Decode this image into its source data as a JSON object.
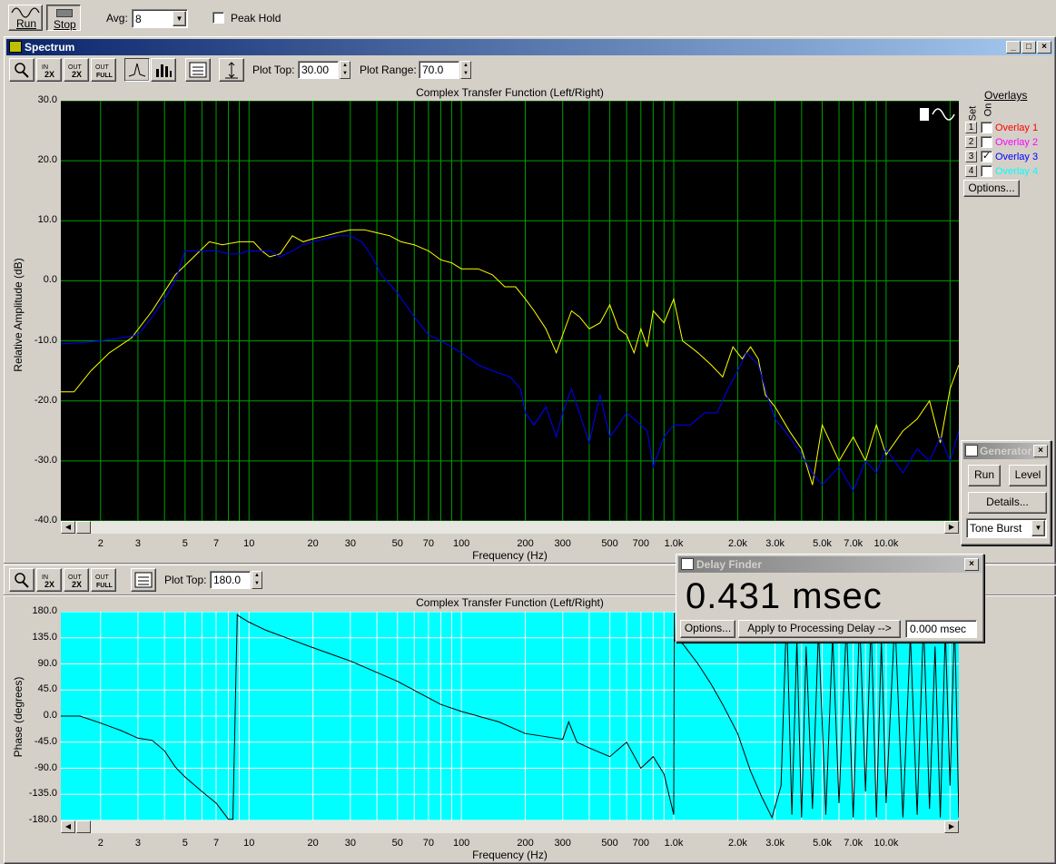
{
  "toolbar": {
    "run_label": "Run",
    "stop_label": "Stop",
    "avg_label": "Avg:",
    "avg_value": "8",
    "peak_hold_label": "Peak Hold"
  },
  "spectrum_window": {
    "title": "Spectrum",
    "plot_top_label": "Plot Top:",
    "plot_top_value": "30.00",
    "plot_range_label": "Plot Range:",
    "plot_range_value": "70.0"
  },
  "phase_toolbar": {
    "plot_top_label": "Plot Top:",
    "plot_top_value": "180.0"
  },
  "overlays": {
    "title": "Overlays",
    "set_label": "Set",
    "on_label": "On",
    "items": [
      {
        "num": "1",
        "label": "Overlay 1",
        "color": "#ff0000",
        "checked": false
      },
      {
        "num": "2",
        "label": "Overlay 2",
        "color": "#ff00ff",
        "checked": false
      },
      {
        "num": "3",
        "label": "Overlay 3",
        "color": "#0000ff",
        "checked": true
      },
      {
        "num": "4",
        "label": "Overlay 4",
        "color": "#00ffff",
        "checked": false
      }
    ],
    "options_label": "Options..."
  },
  "generator": {
    "title": "Generator",
    "run_label": "Run",
    "level_label": "Level",
    "details_label": "Details...",
    "signal_value": "Tone Burst"
  },
  "delay_finder": {
    "title": "Delay Finder",
    "value": "0.431 msec",
    "options_label": "Options...",
    "apply_label": "Apply to Processing Delay -->",
    "delay_value": "0.000 msec"
  },
  "chart_data": [
    {
      "type": "line",
      "title": "Complex Transfer Function (Left/Right)",
      "xlabel": "Frequency (Hz)",
      "ylabel": "Relative Amplitude (dB)",
      "x_scale": "log",
      "xlim": [
        1.3,
        22000
      ],
      "ylim": [
        -40,
        30
      ],
      "yticks": [
        "30.0",
        "20.0",
        "10.0",
        "0.0",
        "-10.0",
        "-20.0",
        "-30.0",
        "-40.0"
      ],
      "xticks": [
        {
          "v": 2,
          "label": "2"
        },
        {
          "v": 3,
          "label": "3"
        },
        {
          "v": 5,
          "label": "5"
        },
        {
          "v": 7,
          "label": "7"
        },
        {
          "v": 10,
          "label": "10"
        },
        {
          "v": 20,
          "label": "20"
        },
        {
          "v": 30,
          "label": "30"
        },
        {
          "v": 50,
          "label": "50"
        },
        {
          "v": 70,
          "label": "70"
        },
        {
          "v": 100,
          "label": "100"
        },
        {
          "v": 200,
          "label": "200"
        },
        {
          "v": 300,
          "label": "300"
        },
        {
          "v": 500,
          "label": "500"
        },
        {
          "v": 700,
          "label": "700"
        },
        {
          "v": 1000,
          "label": "1.0k"
        },
        {
          "v": 2000,
          "label": "2.0k"
        },
        {
          "v": 3000,
          "label": "3.0k"
        },
        {
          "v": 5000,
          "label": "5.0k"
        },
        {
          "v": 7000,
          "label": "7.0k"
        },
        {
          "v": 10000,
          "label": "10.0k"
        }
      ],
      "background": "#000000",
      "grid_color": "#00a000",
      "series": [
        {
          "color": "#ffff00",
          "x": [
            1.3,
            1.5,
            1.8,
            2.2,
            2.8,
            3.5,
            4.5,
            5.5,
            6.5,
            7.5,
            9,
            10.5,
            11.5,
            12.5,
            14,
            16,
            18,
            20,
            23,
            26,
            30,
            35,
            40,
            46,
            52,
            60,
            70,
            80,
            90,
            100,
            120,
            140,
            160,
            180,
            200,
            220,
            250,
            280,
            300,
            330,
            360,
            400,
            450,
            500,
            550,
            600,
            650,
            700,
            750,
            800,
            900,
            1000,
            1100,
            1200,
            1300,
            1500,
            1700,
            1900,
            2100,
            2300,
            2500,
            2700,
            3000,
            3500,
            4000,
            4500,
            5000,
            6000,
            7000,
            8000,
            9000,
            10000,
            12000,
            14000,
            16000,
            18000,
            20000,
            22000
          ],
          "y": [
            -18.5,
            -18.5,
            -15,
            -12,
            -9.5,
            -5,
            1,
            4,
            6.5,
            6,
            6.5,
            6.5,
            5,
            4,
            4.5,
            7.5,
            6.5,
            7,
            7.5,
            8,
            8.5,
            8.5,
            8,
            7.5,
            6.5,
            6,
            5,
            3.5,
            3,
            2,
            2,
            1,
            -1,
            -1,
            -3,
            -5,
            -8,
            -12,
            -9,
            -5,
            -6,
            -8,
            -7,
            -4,
            -8,
            -9,
            -12,
            -8,
            -11,
            -5,
            -7,
            -3,
            -10,
            -11,
            -12,
            -14,
            -16,
            -11,
            -13,
            -11,
            -13,
            -19,
            -21,
            -25,
            -28,
            -34,
            -24,
            -30,
            -26,
            -30,
            -24,
            -29,
            -25,
            -23,
            -20,
            -27,
            -18,
            -14
          ]
        },
        {
          "color": "#0000ff",
          "x": [
            1.3,
            1.6,
            2,
            2.5,
            3,
            3.5,
            4,
            4.5,
            5,
            5.5,
            6,
            7,
            8,
            9,
            10,
            11.5,
            12.5,
            14,
            16,
            18,
            20,
            23,
            26,
            30,
            34,
            38,
            42,
            50,
            60,
            70,
            80,
            90,
            100,
            120,
            140,
            170,
            190,
            200,
            220,
            250,
            280,
            300,
            330,
            360,
            400,
            450,
            500,
            550,
            600,
            700,
            750,
            800,
            900,
            1000,
            1200,
            1400,
            1600,
            1800,
            2000,
            2200,
            2500,
            2800,
            3000,
            3500,
            4000,
            4500,
            5000,
            6000,
            7000,
            8000,
            9000,
            10000,
            12000,
            14000,
            16000,
            18000,
            20000,
            22000
          ],
          "y": [
            -10.5,
            -10.3,
            -10,
            -9.5,
            -9,
            -6,
            -3,
            0,
            5,
            5,
            5,
            5,
            4.5,
            4.5,
            5,
            5,
            5,
            4,
            5,
            6,
            6.5,
            7,
            7.5,
            7.5,
            6.5,
            4,
            1,
            -2,
            -6,
            -9,
            -10,
            -11,
            -12,
            -14,
            -15,
            -16,
            -18,
            -22,
            -24,
            -21,
            -26,
            -22,
            -18,
            -22,
            -27,
            -19,
            -26,
            -24,
            -22,
            -24,
            -25,
            -31,
            -26,
            -24,
            -24,
            -22,
            -22,
            -18,
            -15,
            -12,
            -14,
            -20,
            -23,
            -26,
            -29,
            -32,
            -34,
            -31,
            -35,
            -30,
            -32,
            -28,
            -32,
            -28,
            -30,
            -26,
            -30,
            -25
          ]
        }
      ]
    },
    {
      "type": "line",
      "title": "Complex Transfer Function (Left/Right)",
      "xlabel": "Frequency (Hz)",
      "ylabel": "Phase (degrees)",
      "x_scale": "log",
      "xlim": [
        1.3,
        22000
      ],
      "ylim": [
        -180,
        180
      ],
      "yticks": [
        "180.0",
        "135.0",
        "90.0",
        "45.0",
        "0.0",
        "-45.0",
        "-90.0",
        "-135.0",
        "-180.0"
      ],
      "xticks": [
        {
          "v": 2,
          "label": "2"
        },
        {
          "v": 3,
          "label": "3"
        },
        {
          "v": 5,
          "label": "5"
        },
        {
          "v": 7,
          "label": "7"
        },
        {
          "v": 10,
          "label": "10"
        },
        {
          "v": 20,
          "label": "20"
        },
        {
          "v": 30,
          "label": "30"
        },
        {
          "v": 50,
          "label": "50"
        },
        {
          "v": 70,
          "label": "70"
        },
        {
          "v": 100,
          "label": "100"
        },
        {
          "v": 200,
          "label": "200"
        },
        {
          "v": 300,
          "label": "300"
        },
        {
          "v": 500,
          "label": "500"
        },
        {
          "v": 700,
          "label": "700"
        },
        {
          "v": 1000,
          "label": "1.0k"
        },
        {
          "v": 2000,
          "label": "2.0k"
        },
        {
          "v": 3000,
          "label": "3.0k"
        },
        {
          "v": 5000,
          "label": "5.0k"
        },
        {
          "v": 7000,
          "label": "7.0k"
        },
        {
          "v": 10000,
          "label": "10.0k"
        }
      ],
      "background": "#00ffff",
      "grid_color": "#ffffff",
      "series": [
        {
          "color": "#000000",
          "x": [
            1.3,
            1.6,
            2,
            2.5,
            3,
            3.5,
            4,
            4.5,
            5,
            6,
            7,
            8,
            8.4,
            8.8,
            9,
            10,
            12,
            15,
            20,
            30,
            50,
            80,
            100,
            150,
            200,
            300,
            320,
            350,
            400,
            500,
            600,
            700,
            800,
            900,
            1000,
            1005,
            1010,
            1100,
            1300,
            1500,
            1700,
            2000,
            2300,
            2600,
            2900,
            3200,
            3400,
            3600,
            3800,
            4000,
            4200,
            4500,
            4800,
            5200,
            5600,
            6000,
            6500,
            7000,
            7500,
            8000,
            8500,
            9000,
            9500,
            10000,
            11000,
            12000,
            13000,
            14000,
            15000,
            16000,
            17000,
            18000,
            19000,
            20000,
            21000,
            22000
          ],
          "y": [
            0,
            0,
            -12,
            -25,
            -38,
            -42,
            -60,
            -88,
            -105,
            -130,
            -150,
            -178,
            -178,
            175,
            172,
            162,
            148,
            135,
            118,
            95,
            60,
            20,
            8,
            -10,
            -30,
            -40,
            -10,
            -45,
            -55,
            -70,
            -45,
            -90,
            -70,
            -100,
            -170,
            178,
            130,
            125,
            90,
            55,
            20,
            -30,
            -95,
            -140,
            -175,
            -120,
            178,
            -170,
            130,
            -175,
            120,
            -160,
            150,
            -170,
            140,
            -150,
            160,
            -175,
            170,
            -130,
            160,
            -175,
            130,
            -150,
            170,
            -175,
            140,
            -170,
            165,
            -160,
            120,
            -175,
            150,
            -120,
            170,
            -175
          ]
        }
      ]
    }
  ]
}
